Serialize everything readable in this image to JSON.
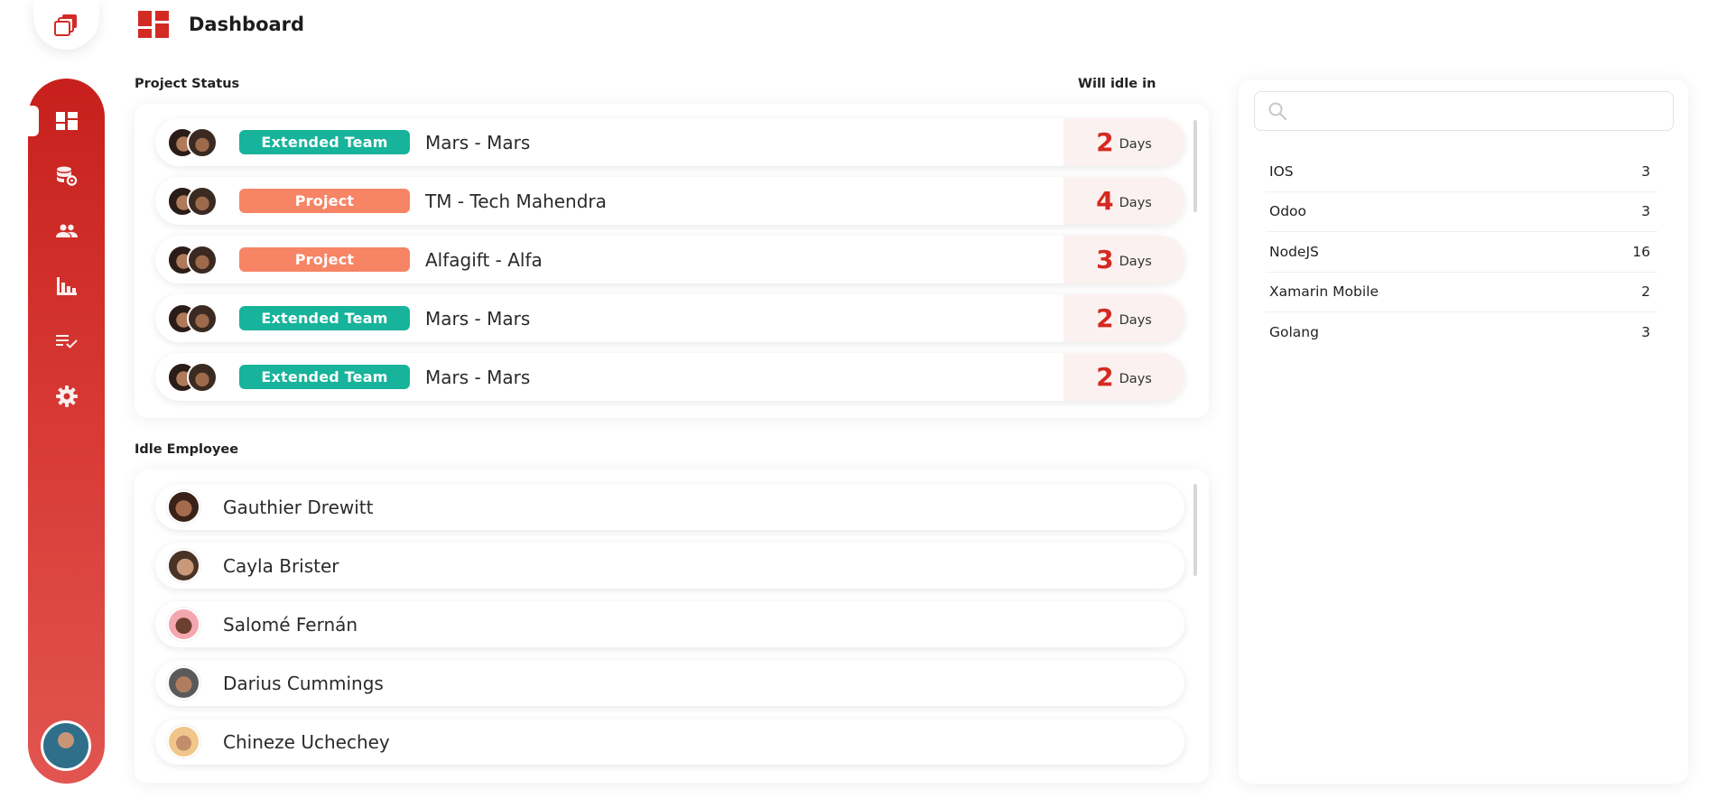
{
  "header": {
    "title": "Dashboard"
  },
  "project_status": {
    "label": "Project Status",
    "idle_label": "Will idle in",
    "rows": [
      {
        "tag": "Extended Team",
        "tag_type": "team",
        "name": "Mars - Mars",
        "days": "2",
        "unit": "Days"
      },
      {
        "tag": "Project",
        "tag_type": "project",
        "name": "TM - Tech Mahendra",
        "days": "4",
        "unit": "Days"
      },
      {
        "tag": "Project",
        "tag_type": "project",
        "name": "Alfagift - Alfa",
        "days": "3",
        "unit": "Days"
      },
      {
        "tag": "Extended Team",
        "tag_type": "team",
        "name": "Mars - Mars",
        "days": "2",
        "unit": "Days"
      },
      {
        "tag": "Extended Team",
        "tag_type": "team",
        "name": "Mars - Mars",
        "days": "2",
        "unit": "Days"
      }
    ]
  },
  "idle_employee": {
    "label": "Idle Employee",
    "rows": [
      {
        "name": "Gauthier Drewitt"
      },
      {
        "name": "Cayla Brister"
      },
      {
        "name": "Salomé Fernán"
      },
      {
        "name": "Darius Cummings"
      },
      {
        "name": "Chineze Uchechey"
      }
    ]
  },
  "tech": {
    "search_placeholder": "",
    "items": [
      {
        "name": "IOS",
        "count": "3"
      },
      {
        "name": "Odoo",
        "count": "3"
      },
      {
        "name": "NodeJS",
        "count": "16"
      },
      {
        "name": "Xamarin Mobile",
        "count": "2"
      },
      {
        "name": "Golang",
        "count": "3"
      }
    ]
  },
  "sidebar": {
    "items": [
      {
        "icon": "dashboard-icon",
        "active": true
      },
      {
        "icon": "database-settings-icon",
        "active": false
      },
      {
        "icon": "people-icon",
        "active": false
      },
      {
        "icon": "bar-chart-icon",
        "active": false
      },
      {
        "icon": "checklist-icon",
        "active": false
      },
      {
        "icon": "gear-icon",
        "active": false
      }
    ]
  },
  "colors": {
    "brand_red": "#c7201c",
    "tag_team": "#17b39b",
    "tag_project": "#f78465",
    "days_number": "#d42a22"
  }
}
